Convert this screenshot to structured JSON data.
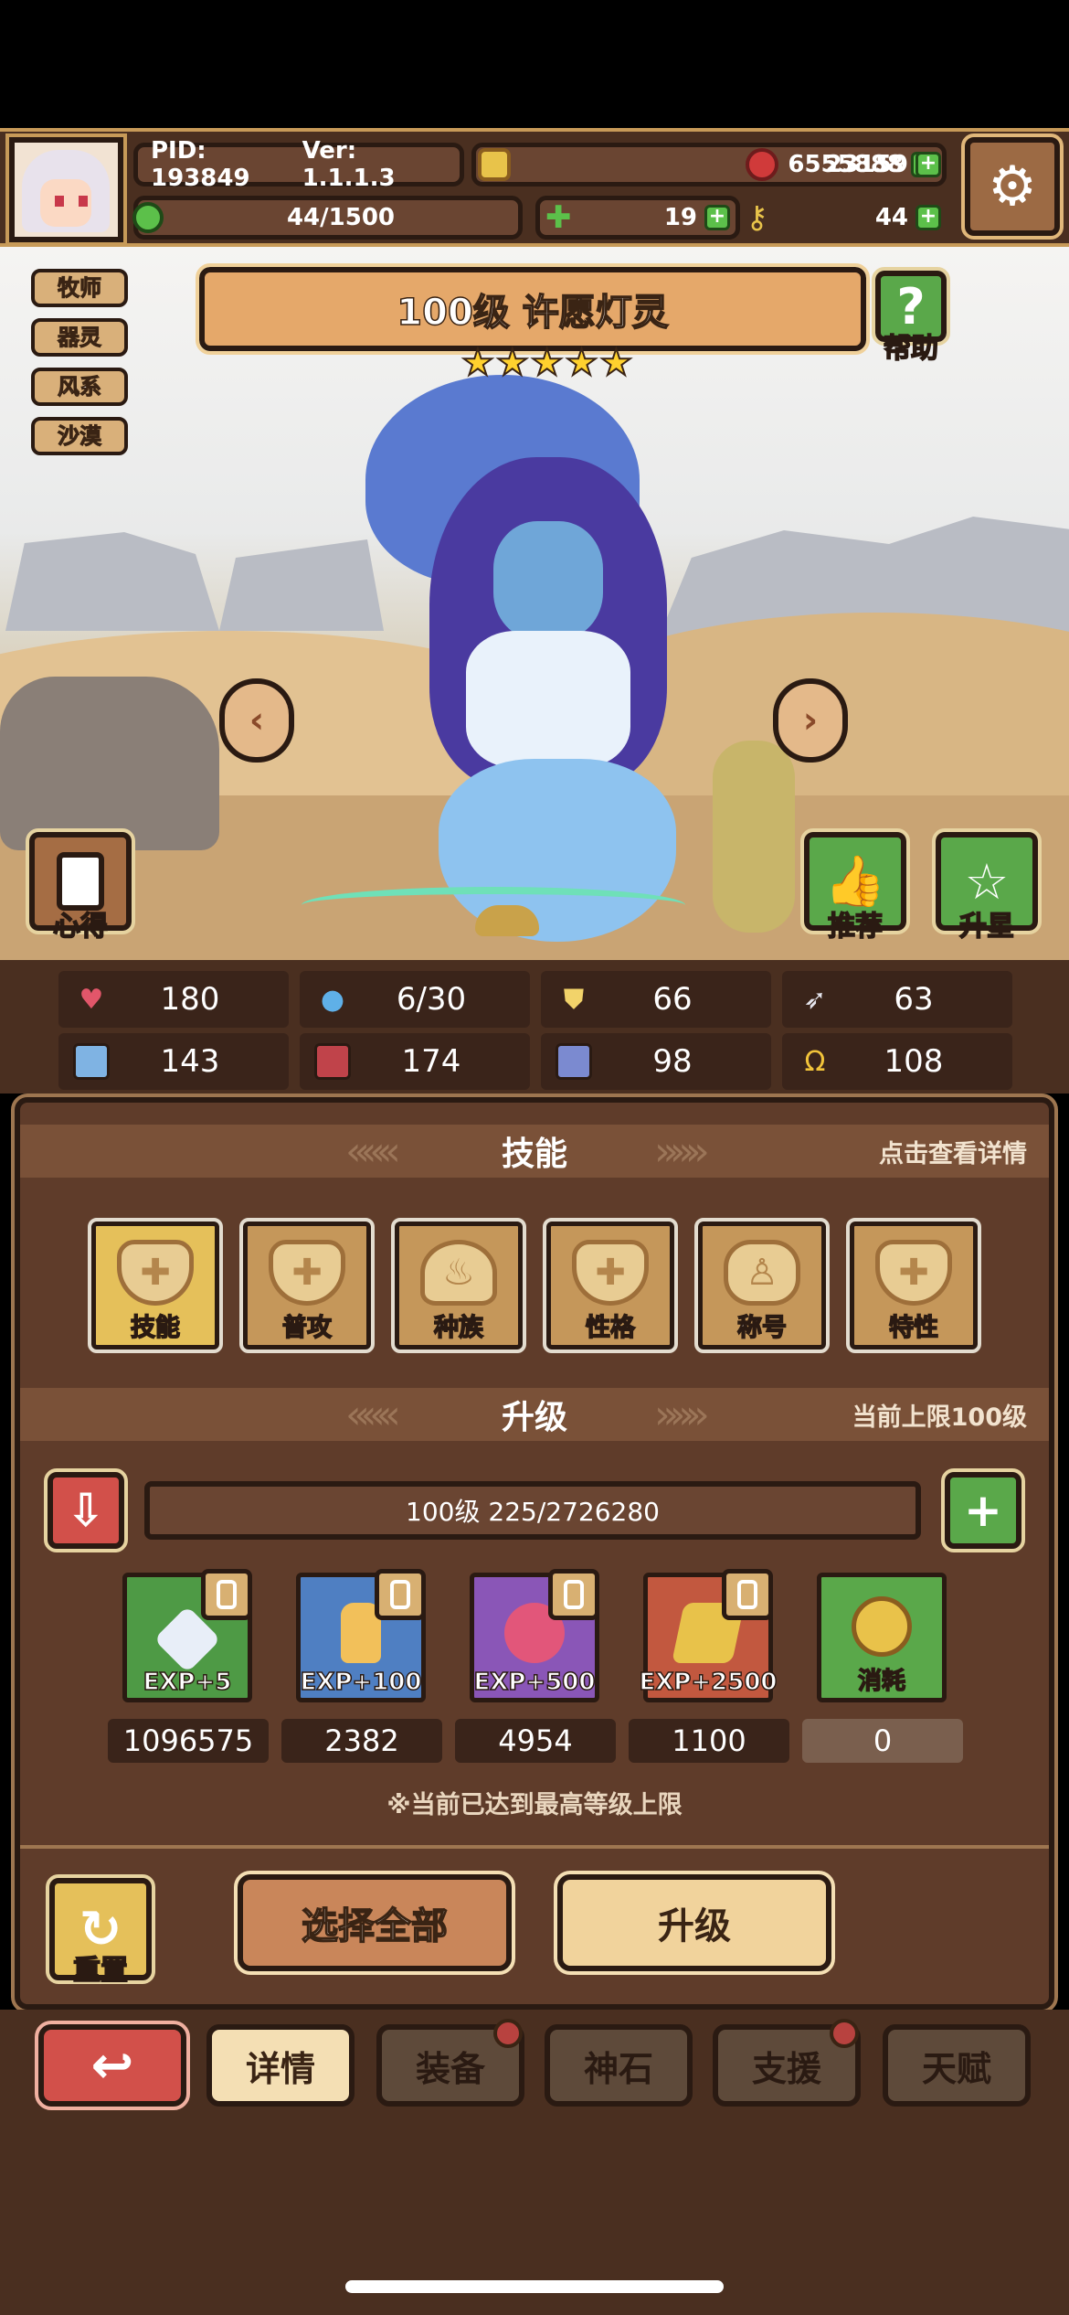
{
  "header": {
    "pid": "PID: 193849",
    "version": "Ver: 1.1.1.3",
    "gold": "6555888",
    "ruby": "23159",
    "stamina": "44/1500",
    "clover": "19",
    "key": "44"
  },
  "character": {
    "tags": [
      "牧师",
      "器灵",
      "风系",
      "沙漠"
    ],
    "title": "100级 许愿灯灵",
    "stars": 5,
    "help_label": "帮助",
    "notes_label": "心得",
    "recommend_label": "推荐",
    "star_up_label": "升星"
  },
  "stats": {
    "row1": [
      "180",
      "6/30",
      "66",
      "63"
    ],
    "row2": [
      "143",
      "174",
      "98",
      "108"
    ]
  },
  "skills": {
    "header": "技能",
    "hint": "点击查看详情",
    "items": [
      "技能",
      "普攻",
      "种族",
      "性格",
      "称号",
      "特性"
    ]
  },
  "upgrade": {
    "header": "升级",
    "cap": "当前上限100级",
    "progress": "100级  225/2726280",
    "items": [
      {
        "label": "EXP+5",
        "count": "1096575",
        "color": "#4e9a45"
      },
      {
        "label": "EXP+100",
        "count": "2382",
        "color": "#4f7fc2"
      },
      {
        "label": "EXP+500",
        "count": "4954",
        "color": "#8a56b7"
      },
      {
        "label": "EXP+2500",
        "count": "1100",
        "color": "#c2583f"
      },
      {
        "label": "消耗",
        "count": "0",
        "color": "#5aa84a"
      }
    ],
    "note": "※当前已达到最高等级上限",
    "reset_label": "重置",
    "select_all_label": "选择全部",
    "upgrade_label": "升级"
  },
  "nav": {
    "tabs": [
      "详情",
      "装备",
      "神石",
      "支援",
      "天赋"
    ]
  },
  "colors": {
    "frame": "#4a2f20",
    "accent_gold": "#c79a58",
    "green": "#5aa84a",
    "red": "#d2504a"
  }
}
